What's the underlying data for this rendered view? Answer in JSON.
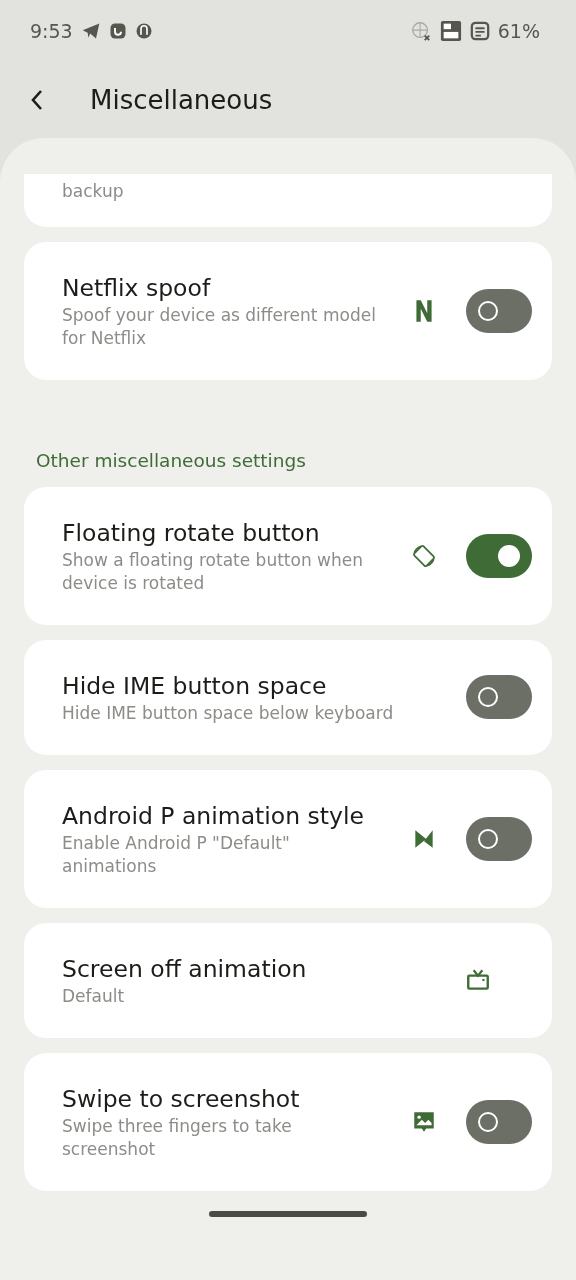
{
  "status_bar": {
    "time": "9:53",
    "battery": "61%"
  },
  "header": {
    "title": "Miscellaneous"
  },
  "sections": [
    {
      "items": [
        {
          "kind": "partial",
          "summary": "backup"
        },
        {
          "kind": "switch",
          "title": "Netflix spoof",
          "summary": "Spoof your device as different model for Netflix",
          "on": false
        }
      ]
    },
    {
      "header": "Other miscellaneous settings",
      "items": [
        {
          "kind": "switch",
          "title": "Floating rotate button",
          "summary": "Show a floating rotate button when device is rotated",
          "on": true
        },
        {
          "kind": "switch",
          "title": "Hide IME button space",
          "summary": "Hide IME button space below keyboard",
          "on": false
        },
        {
          "kind": "switch",
          "title": "Android P animation style",
          "summary": "Enable Android P \"Default\" animations",
          "on": false
        },
        {
          "kind": "link",
          "title": "Screen off animation",
          "summary": "Default"
        },
        {
          "kind": "switch",
          "title": "Swipe to screenshot",
          "summary": "Swipe three fingers to take screenshot",
          "on": false
        }
      ]
    }
  ]
}
